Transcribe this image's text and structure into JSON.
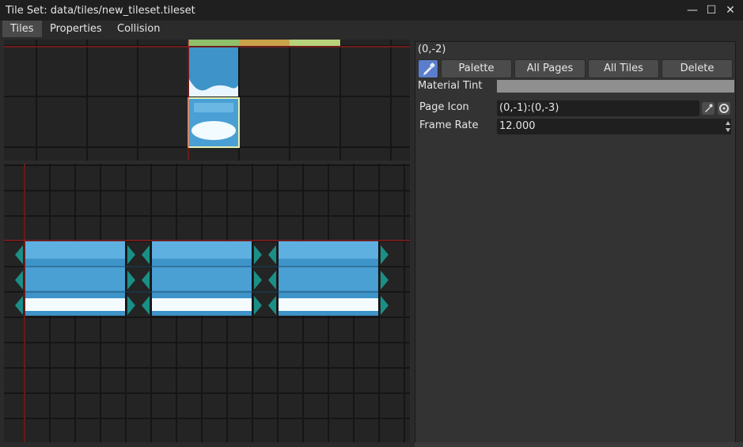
{
  "window": {
    "title": "Tile Set: data/tiles/new_tileset.tileset",
    "minimize_glyph": "—",
    "maximize_glyph": "☐",
    "close_glyph": "✕"
  },
  "tabs": [
    {
      "label": "Tiles",
      "active": true
    },
    {
      "label": "Properties",
      "active": false
    },
    {
      "label": "Collision",
      "active": false
    }
  ],
  "inspector": {
    "coordinate": "(0,-2)",
    "buttons": {
      "picker_icon": "eyedropper-icon",
      "palette": "Palette",
      "all_pages": "All Pages",
      "all_tiles": "All Tiles",
      "delete": "Delete"
    },
    "material_tint": {
      "label": "Material Tint",
      "color": "#8f8f8f"
    },
    "page_icon": {
      "label": "Page Icon",
      "value": "(0,-1):(0,-3)"
    },
    "frame_rate": {
      "label": "Frame Rate",
      "value": "12.000"
    }
  },
  "colors": {
    "accent": "#5a7ecb",
    "guide_line": "#c0201e",
    "tile_water": "#3e94c8",
    "arrow_teal": "#1a8f86",
    "selection": "#e8f0b0"
  }
}
